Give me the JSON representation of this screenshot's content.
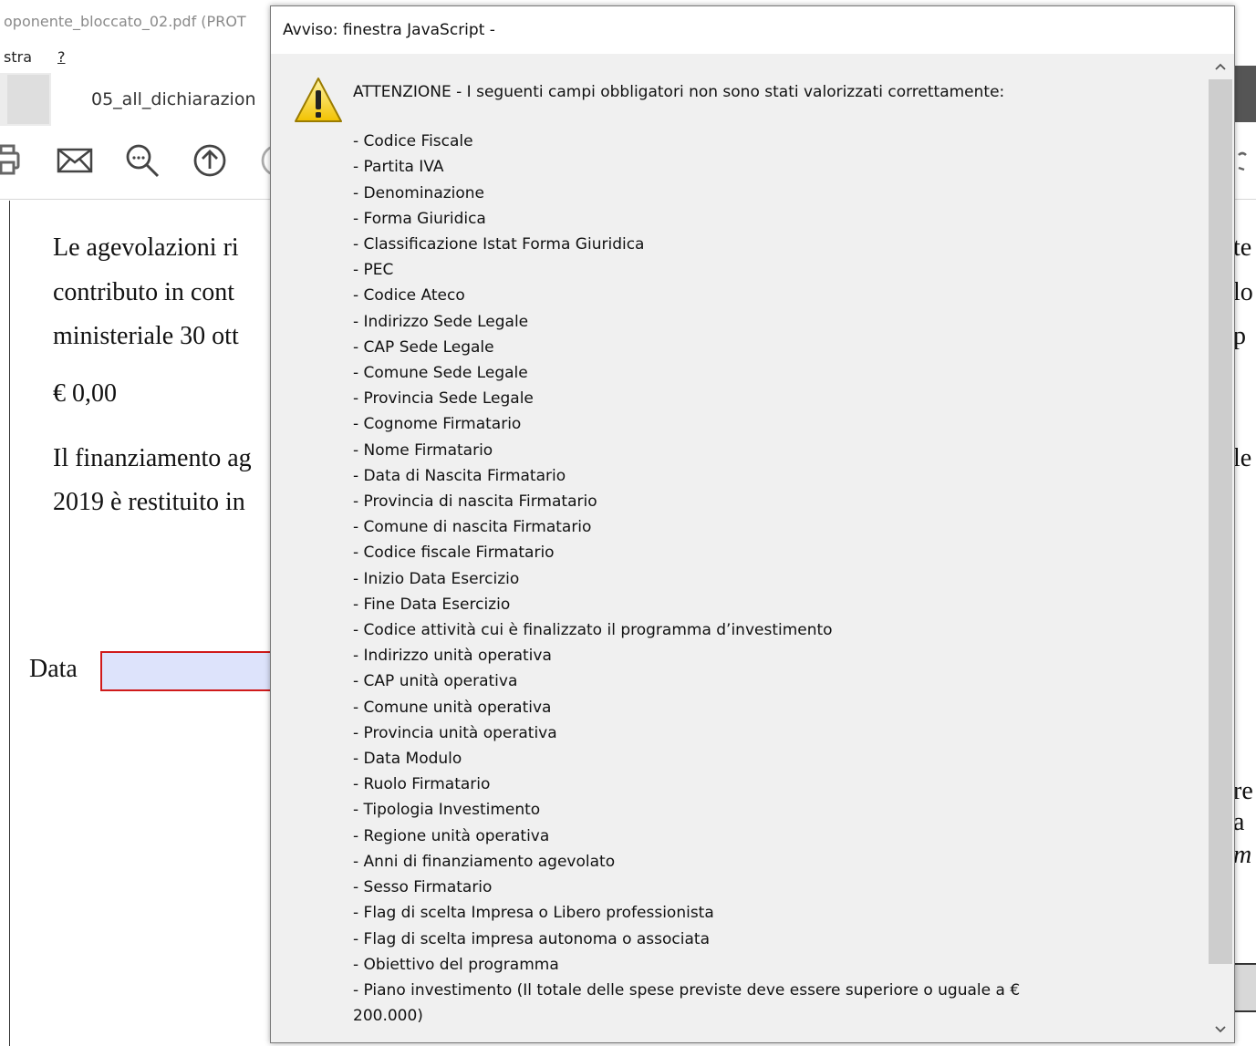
{
  "background": {
    "window_title": "oponente_bloccato_02.pdf (PROT",
    "menu": {
      "item_1": "stra",
      "item_help": "?"
    },
    "tab": {
      "doc_label": "05_all_dichiarazion"
    },
    "toolbar": {
      "icons": [
        "print-icon",
        "email-icon",
        "zoom-icon",
        "upload-icon"
      ]
    },
    "document": {
      "line_1": "Le agevolazioni ri",
      "line_2": "contributo in cont",
      "line_3": "ministeriale 30 ott",
      "amount": "€ 0,00",
      "line_4": "Il finanziamento ag",
      "line_5": "2019 è restituito in",
      "date_label": "Data",
      "right_fragments": [
        "te",
        "lo",
        "p",
        "le",
        "re",
        "a",
        "m"
      ]
    }
  },
  "dialog": {
    "title": "Avviso: finestra JavaScript -",
    "icon": "warning-icon",
    "header": "ATTENZIONE - I seguenti campi obbligatori non sono stati valorizzati correttamente:",
    "fields": [
      "- Codice Fiscale",
      "- Partita IVA",
      "- Denominazione",
      "- Forma Giuridica",
      "- Classificazione Istat Forma Giuridica",
      "- PEC",
      "- Codice Ateco",
      "- Indirizzo Sede Legale",
      "- CAP Sede Legale",
      "- Comune Sede Legale",
      "- Provincia Sede Legale",
      "- Cognome Firmatario",
      "- Nome Firmatario",
      "- Data di Nascita Firmatario",
      "- Provincia di nascita Firmatario",
      "- Comune di nascita Firmatario",
      "- Codice fiscale Firmatario",
      "- Inizio Data Esercizio",
      "- Fine Data Esercizio",
      "- Codice attività cui è finalizzato il programma d’investimento",
      "- Indirizzo unità operativa",
      "- CAP unità operativa",
      "- Comune unità operativa",
      "- Provincia unità operativa",
      "- Data Modulo",
      "- Ruolo Firmatario",
      "- Tipologia Investimento",
      "- Regione unità operativa",
      "- Anni di finanziamento agevolato",
      "- Sesso Firmatario",
      "- Flag di scelta Impresa o Libero professionista",
      "- Flag di scelta impresa autonoma o associata",
      "- Obiettivo del programma",
      "- Piano investimento (Il totale delle spese previste deve essere superiore o uguale a €",
      "200.000)"
    ],
    "scroll": {
      "up_glyph": "^",
      "down_glyph": "⌄"
    }
  }
}
